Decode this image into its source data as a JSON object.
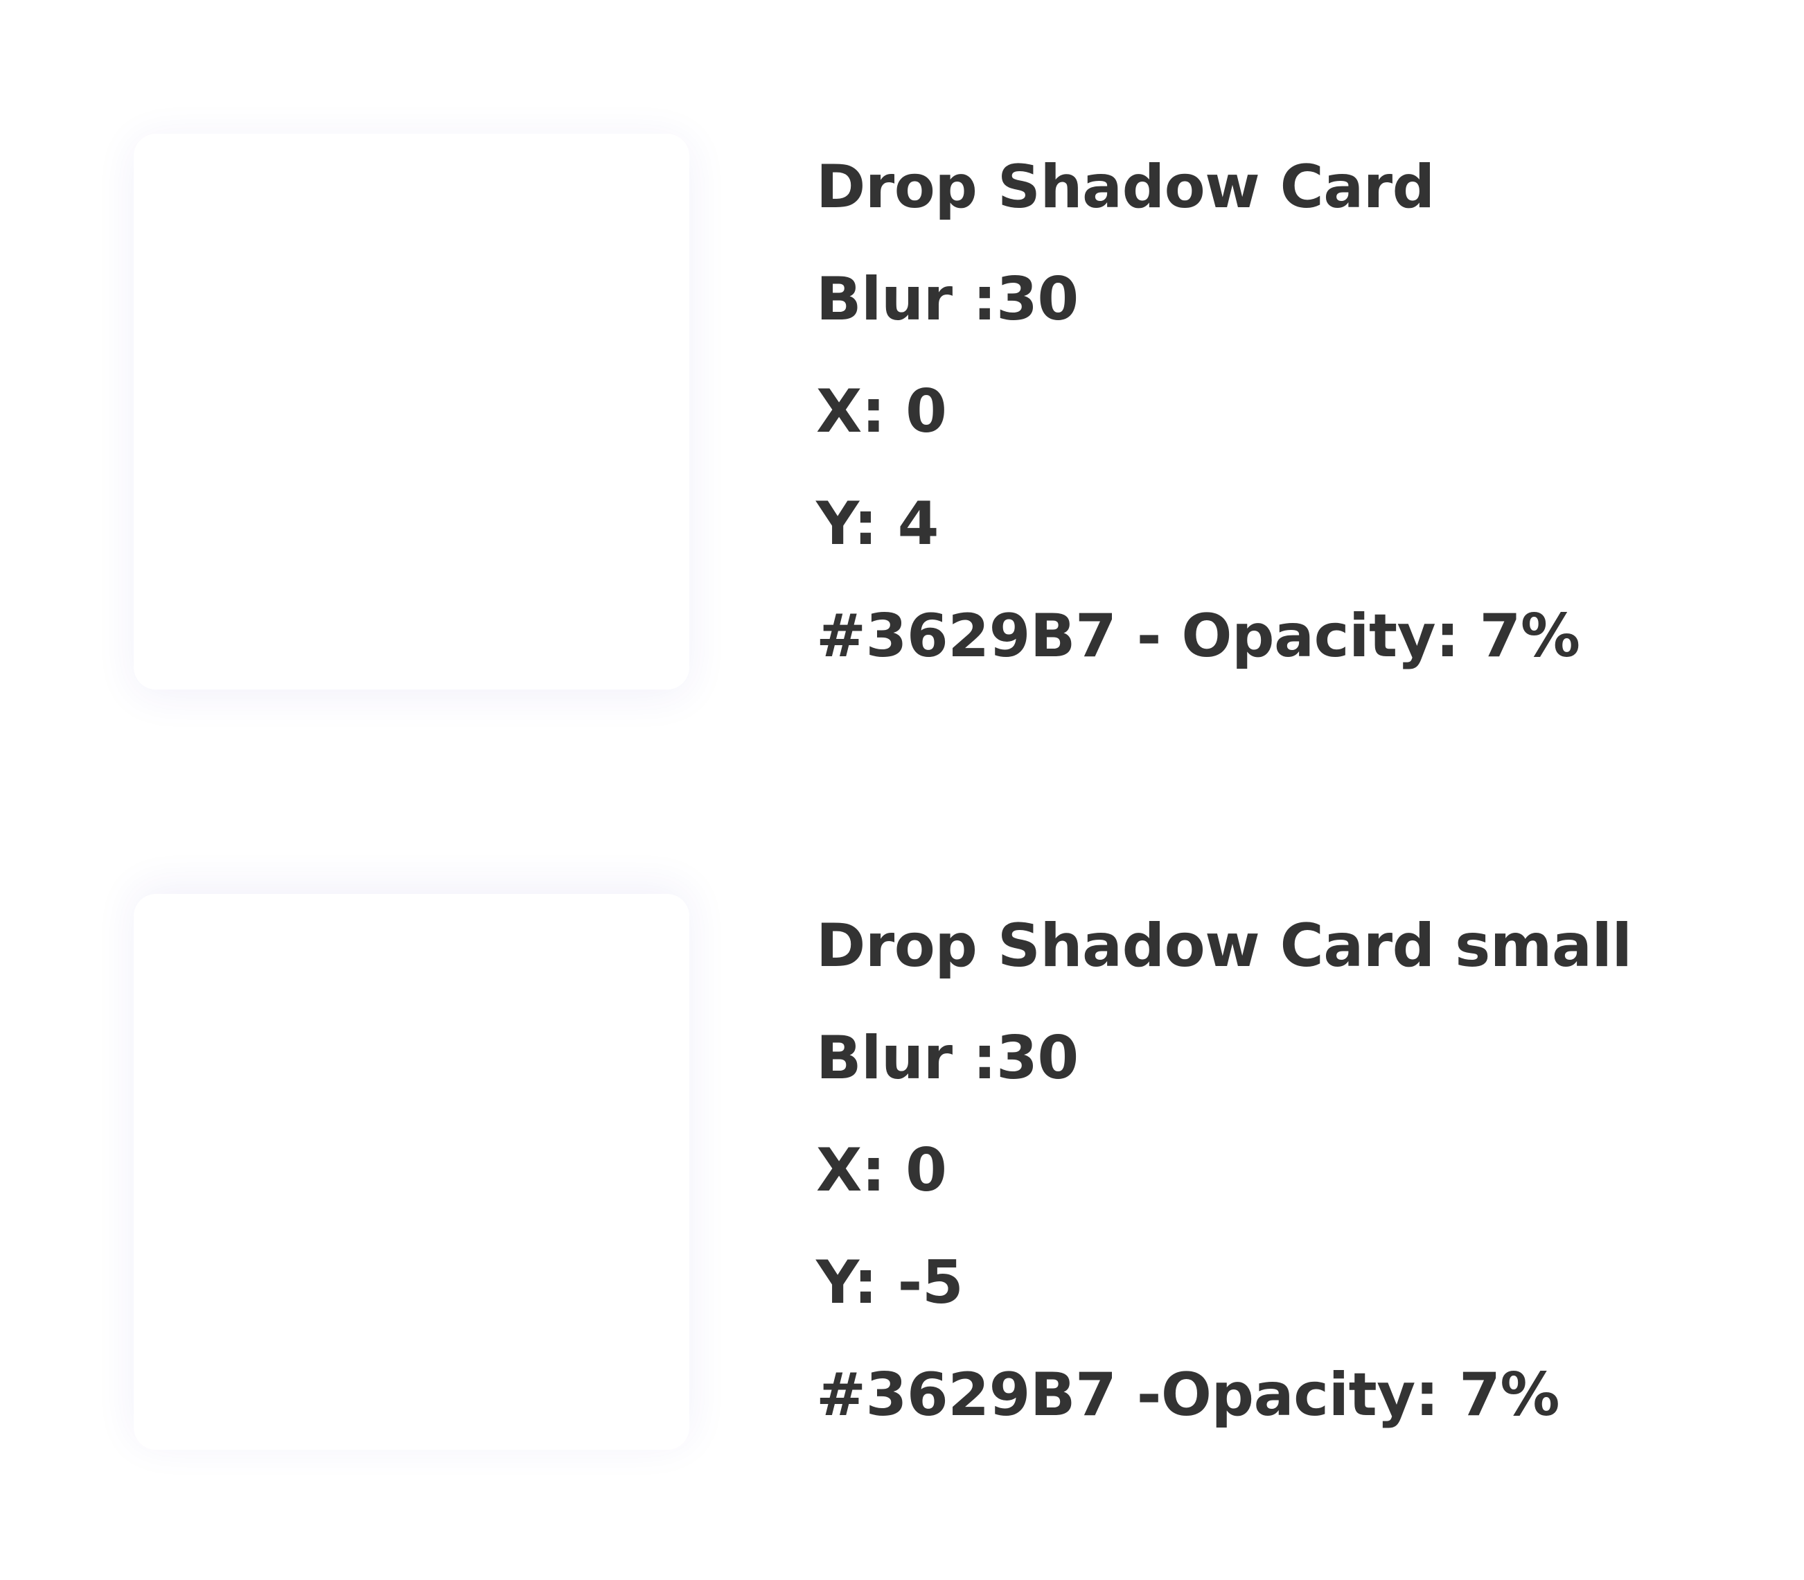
{
  "cards": [
    {
      "title": "Drop Shadow Card",
      "blur": "Blur :30",
      "x": "X: 0",
      "y": "Y: 4",
      "color": "#3629B7 - Opacity: 7%"
    },
    {
      "title": "Drop Shadow Card small",
      "blur": "Blur :30",
      "x": "X: 0",
      "y": "Y: -5",
      "color": "#3629B7 -Opacity: 7%"
    }
  ],
  "shadow_color": "#3629B7",
  "text_color": "#333333"
}
